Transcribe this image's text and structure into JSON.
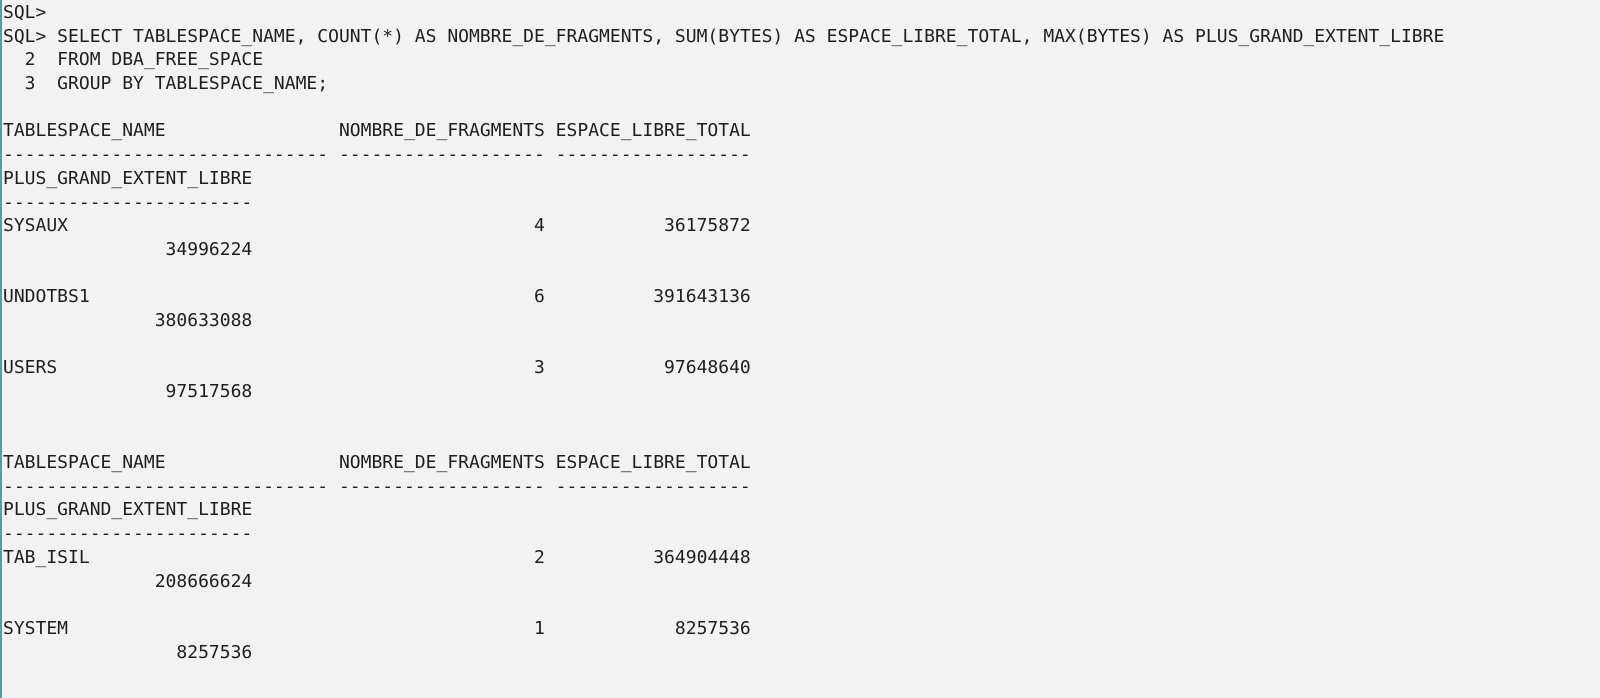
{
  "terminal": {
    "lines": [
      "SQL>",
      "SQL> SELECT TABLESPACE_NAME, COUNT(*) AS NOMBRE_DE_FRAGMENTS, SUM(BYTES) AS ESPACE_LIBRE_TOTAL, MAX(BYTES) AS PLUS_GRAND_EXTENT_LIBRE",
      "  2  FROM DBA_FREE_SPACE",
      "  3  GROUP BY TABLESPACE_NAME;",
      "",
      "TABLESPACE_NAME                NOMBRE_DE_FRAGMENTS ESPACE_LIBRE_TOTAL",
      "------------------------------ ------------------- ------------------",
      "PLUS_GRAND_EXTENT_LIBRE",
      "-----------------------",
      "SYSAUX                                           4           36175872",
      "               34996224",
      "",
      "UNDOTBS1                                         6          391643136",
      "              380633088",
      "",
      "USERS                                            3           97648640",
      "               97517568",
      "",
      "",
      "TABLESPACE_NAME                NOMBRE_DE_FRAGMENTS ESPACE_LIBRE_TOTAL",
      "------------------------------ ------------------- ------------------",
      "PLUS_GRAND_EXTENT_LIBRE",
      "-----------------------",
      "TAB_ISIL                                         2          364904448",
      "              208666624",
      "",
      "SYSTEM                                           1            8257536",
      "                8257536"
    ]
  }
}
